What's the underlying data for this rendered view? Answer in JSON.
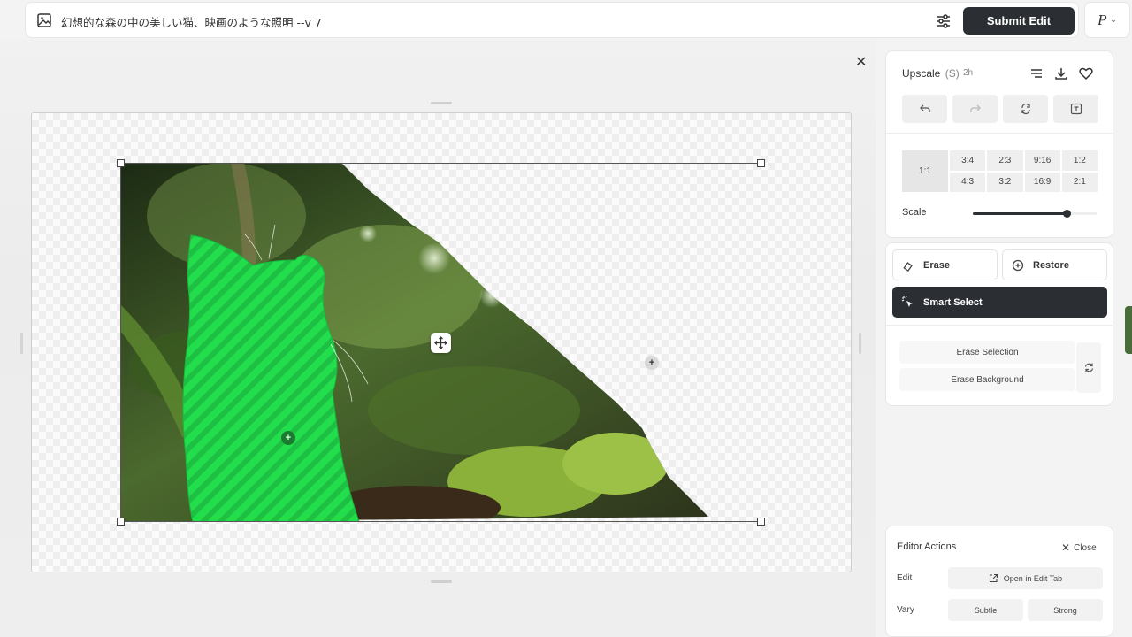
{
  "topbar": {
    "prompt": "幻想的な森の中の美しい猫、映画のような照明 --v 7",
    "submit_label": "Submit Edit",
    "profile_initial": "P"
  },
  "upscale": {
    "title": "Upscale",
    "mode": "(S)",
    "time": "2h"
  },
  "ratios": {
    "square": "1:1",
    "top": [
      "3:4",
      "2:3",
      "9:16",
      "1:2"
    ],
    "bottom": [
      "4:3",
      "3:2",
      "16:9",
      "2:1"
    ]
  },
  "scale": {
    "label": "Scale",
    "value": 0.76
  },
  "tools": {
    "erase_label": "Erase",
    "restore_label": "Restore",
    "smart_select_label": "Smart Select",
    "erase_selection_label": "Erase Selection",
    "erase_background_label": "Erase Background"
  },
  "editor_actions": {
    "title": "Editor Actions",
    "close_label": "Close",
    "edit_label": "Edit",
    "open_edit_tab_label": "Open in Edit Tab",
    "vary_label": "Vary",
    "subtle_label": "Subtle",
    "strong_label": "Strong"
  },
  "icons": [
    "image-icon",
    "sliders-icon",
    "chevron-down-icon",
    "close-icon",
    "menu-icon",
    "download-icon",
    "heart-icon",
    "undo-icon",
    "redo-icon",
    "rotate-icon",
    "text-icon",
    "eraser-icon",
    "plus-circle-icon",
    "pointer-select-icon",
    "refresh-icon",
    "external-link-icon",
    "move-icon"
  ],
  "colors": {
    "accent_dark": "#2b2e33",
    "selection_mask": "#1fd64a"
  }
}
